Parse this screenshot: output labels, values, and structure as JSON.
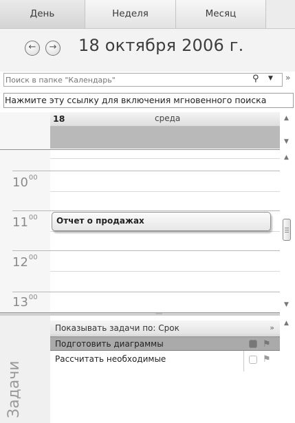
{
  "tabs": [
    {
      "label": "День",
      "active": true
    },
    {
      "label": "Неделя",
      "active": false
    },
    {
      "label": "Месяц",
      "active": false
    }
  ],
  "date_header": {
    "title": "18 октября 2006 г."
  },
  "search": {
    "placeholder": "Поиск в папке \"Календарь\""
  },
  "instant_search_link": "Нажмите эту ссылку для включения мгновенного поиска",
  "day_column": {
    "day_number": "18",
    "weekday": "среда"
  },
  "hours": [
    {
      "hour": "10",
      "minutes": "00"
    },
    {
      "hour": "11",
      "minutes": "00"
    },
    {
      "hour": "12",
      "minutes": "00"
    },
    {
      "hour": "13",
      "minutes": "00"
    }
  ],
  "appointment": {
    "title": "Отчет о продажах"
  },
  "tasks": {
    "side_label": "Задачи",
    "group_header": "Показывать задачи по: Срок",
    "items": [
      {
        "title": "Подготовить диаграммы",
        "selected": true
      },
      {
        "title": "Рассчитать необходимые",
        "selected": false
      }
    ]
  },
  "icons": {
    "back": "circle-arrow-left-icon",
    "forward": "circle-arrow-right-icon",
    "search": "magnifier-icon",
    "flag": "flag-icon"
  },
  "colors": {
    "all_day_band": "#b9b9b9",
    "selected_task": "#aaaaaa"
  }
}
